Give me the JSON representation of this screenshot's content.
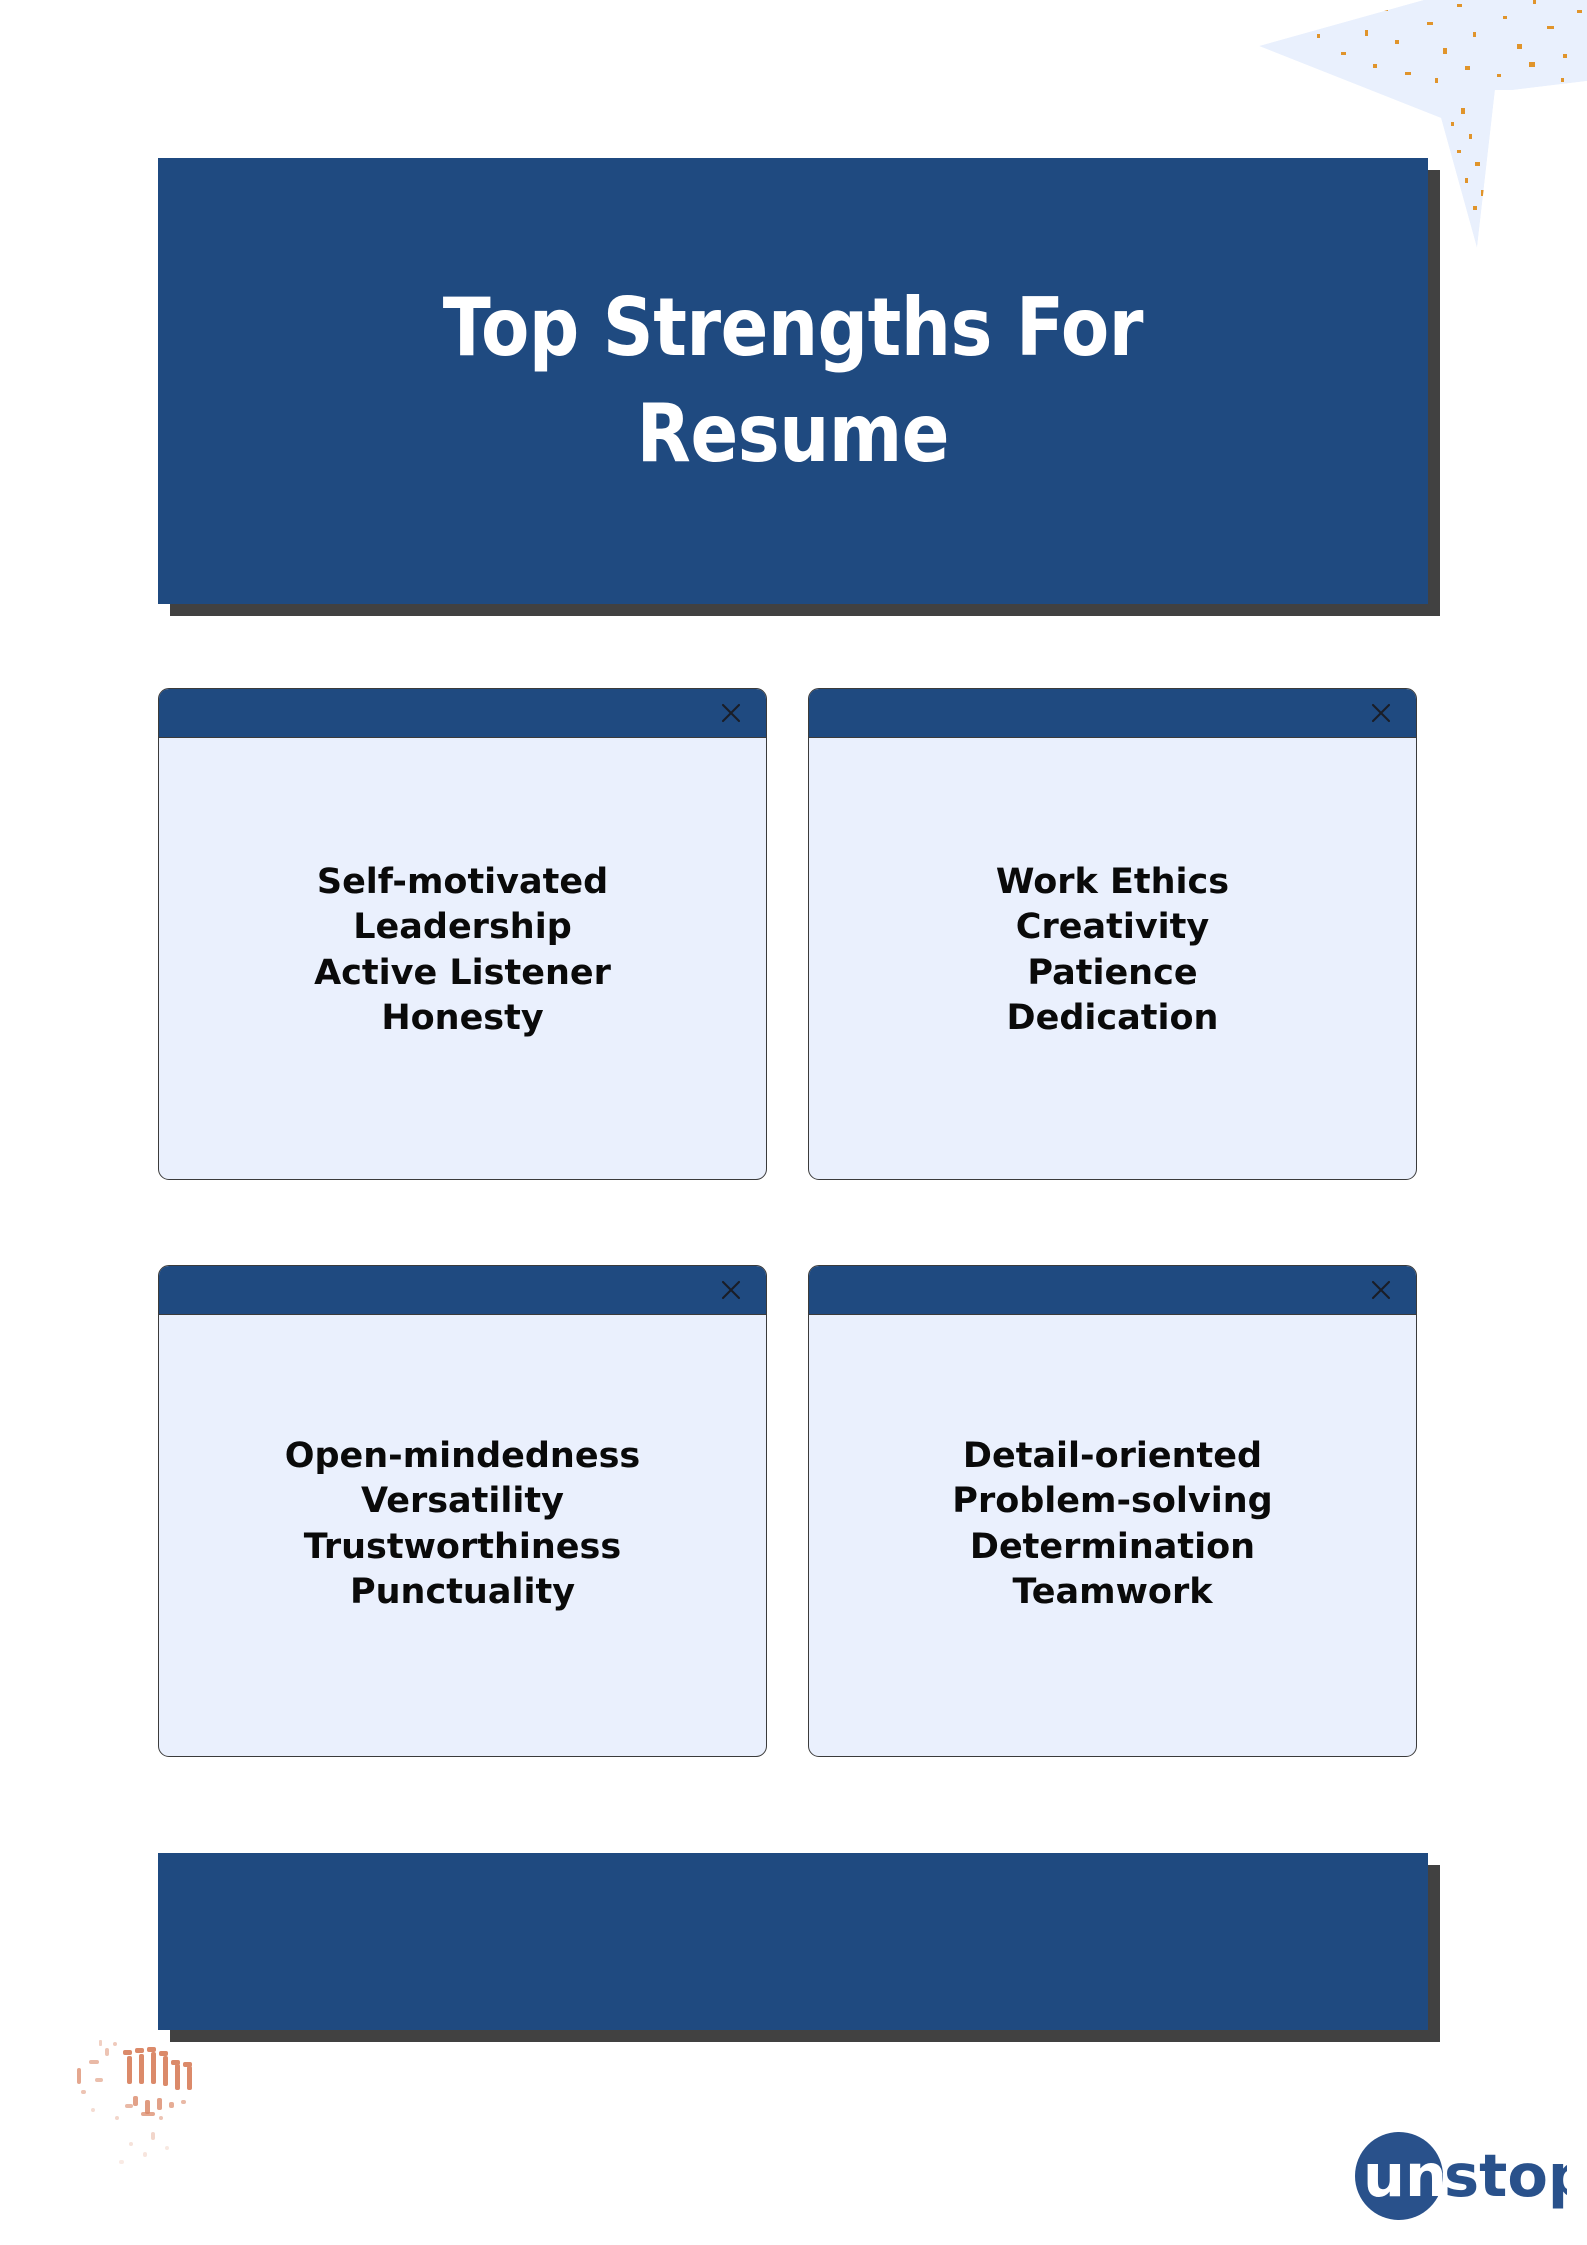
{
  "page": {
    "background_color": "#ffffff",
    "accent_navy": "#1f4a80",
    "shadow_gray": "#414141",
    "card_body_color": "#eaf0fd",
    "speckle_color": "#db8a6a",
    "plane_color": "#e9f0fd",
    "plane_speckle_color": "#e0942b"
  },
  "banner": {
    "title": "Top Strengths For\nResume"
  },
  "cards": [
    {
      "close_icon": "close-icon",
      "lines": [
        "Self-motivated",
        "Leadership",
        "Active Listener",
        "Honesty"
      ]
    },
    {
      "close_icon": "close-icon",
      "lines": [
        "Work Ethics",
        "Creativity",
        "Patience",
        "Dedication"
      ]
    },
    {
      "close_icon": "close-icon",
      "lines": [
        "Open-mindedness",
        "Versatility",
        "Trustworthiness",
        "Punctuality"
      ]
    },
    {
      "close_icon": "close-icon",
      "lines": [
        "Detail-oriented",
        "Problem-solving",
        "Determination",
        "Teamwork"
      ]
    }
  ],
  "footer": {
    "bar_label": ""
  },
  "logo": {
    "mark_text": "un",
    "word_text": "stop",
    "full_name": "unstop",
    "color": "#29518b"
  },
  "decorations": {
    "paper_plane": "paper-plane-icon",
    "speckles": "speckle-texture"
  }
}
